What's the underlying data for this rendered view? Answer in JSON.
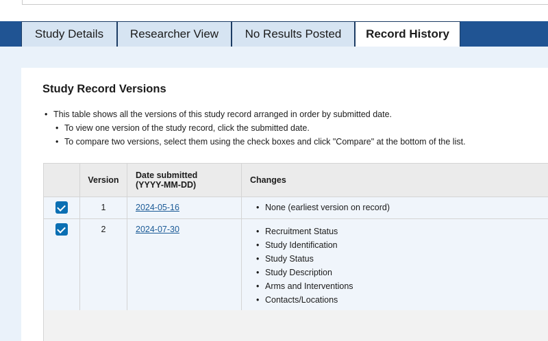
{
  "tabs": [
    {
      "label": "Study Details",
      "active": false
    },
    {
      "label": "Researcher View",
      "active": false
    },
    {
      "label": "No Results Posted",
      "active": false
    },
    {
      "label": "Record History",
      "active": true
    }
  ],
  "section": {
    "title": "Study Record Versions",
    "notes": [
      "This table shows all the versions of this study record arranged in order by submitted date.",
      "To view one version of the study record, click the submitted date.",
      "To compare two versions, select them using the check boxes and click \"Compare\" at the bottom of the list."
    ]
  },
  "table": {
    "headers": {
      "version": "Version",
      "date_line1": "Date submitted",
      "date_line2": "(YYYY-MM-DD)",
      "changes": "Changes"
    },
    "rows": [
      {
        "checked": true,
        "version": "1",
        "date": "2024-05-16",
        "changes": [
          "None (earliest version on record)"
        ]
      },
      {
        "checked": true,
        "version": "2",
        "date": "2024-07-30",
        "changes": [
          "Recruitment Status",
          "Study Identification",
          "Study Status",
          "Study Description",
          "Arms and Interventions",
          "Contacts/Locations"
        ]
      }
    ]
  },
  "colors": {
    "tab_bar": "#205493",
    "tab_inactive": "#d6e4f2",
    "checkbox": "#0b6fb3",
    "link": "#1a5a96"
  }
}
